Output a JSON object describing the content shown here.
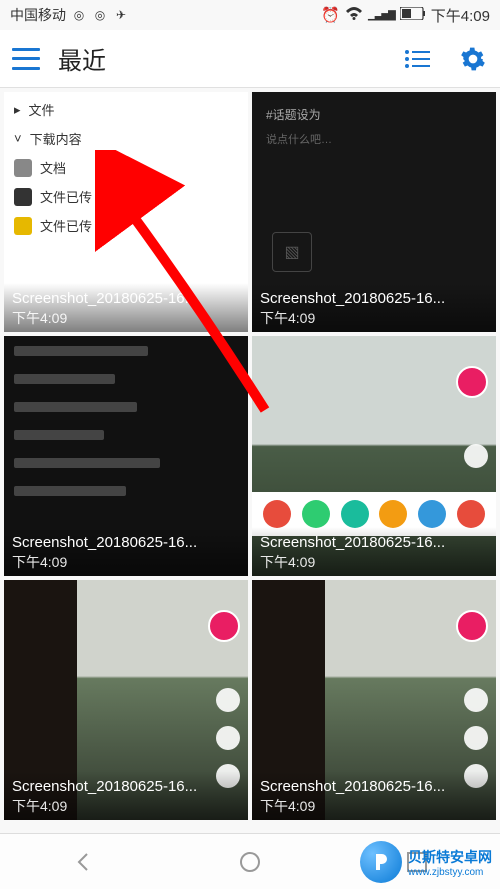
{
  "status": {
    "carrier": "中国移动",
    "time": "下午4:09",
    "icons": {
      "alarm": "⏰",
      "wifi": "📶",
      "signal": "📶",
      "battery": "🔋"
    }
  },
  "header": {
    "title": "最近",
    "menu_icon": "menu",
    "list_icon": "list",
    "settings_icon": "settings"
  },
  "thumbnails": [
    {
      "filename": "Screenshot_20180625-16...",
      "time": "下午4:09",
      "kind": "menu"
    },
    {
      "filename": "Screenshot_20180625-16...",
      "time": "下午4:09",
      "kind": "dark-input"
    },
    {
      "filename": "Screenshot_20180625-16...",
      "time": "下午4:09",
      "kind": "dark-list"
    },
    {
      "filename": "Screenshot_20180625-16...",
      "time": "下午4:09",
      "kind": "share"
    },
    {
      "filename": "Screenshot_20180625-16...",
      "time": "下午4:09",
      "kind": "train"
    },
    {
      "filename": "Screenshot_20180625-16...",
      "time": "下午4:09",
      "kind": "train"
    }
  ],
  "menu_items": [
    "文件",
    "下载内容",
    "文档",
    "文件已传",
    "文件已传"
  ],
  "watermark": {
    "brand": "贝斯特安卓网",
    "url": "www.zjbstyy.com"
  }
}
